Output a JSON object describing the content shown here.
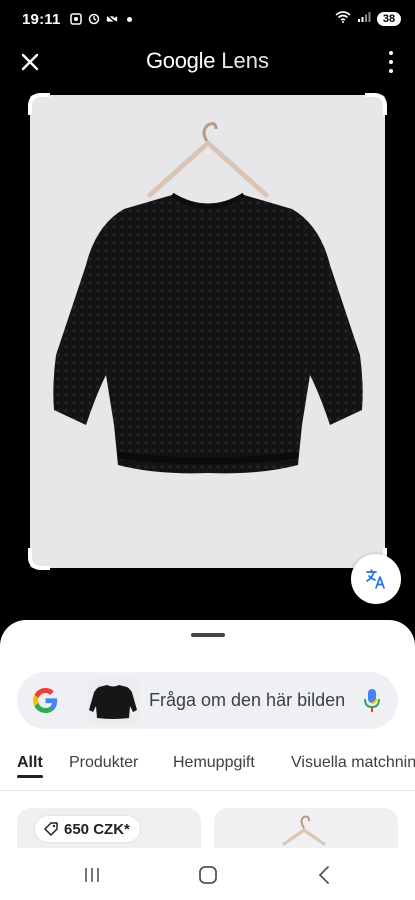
{
  "status_bar": {
    "time": "19:11",
    "battery": "38"
  },
  "header": {
    "title_google": "Google",
    "title_lens": "Lens"
  },
  "search": {
    "placeholder": "Fråga om den här bilden"
  },
  "tabs": [
    {
      "label": "Allt",
      "active": true
    },
    {
      "label": "Produkter",
      "active": false
    },
    {
      "label": "Hemuppgift",
      "active": false
    },
    {
      "label": "Visuella matchningar",
      "active": false
    }
  ],
  "results": [
    {
      "price": "650 CZK*"
    }
  ],
  "colors": {
    "google_blue": "#4285F4",
    "google_red": "#EA4335",
    "google_yellow": "#FBBC05",
    "google_green": "#34A853",
    "translate_blue": "#1a73e8"
  }
}
